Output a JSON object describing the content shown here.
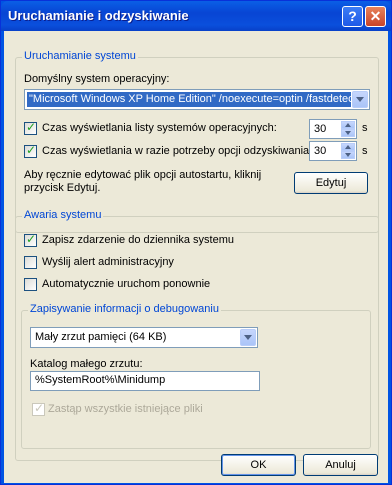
{
  "window": {
    "title": "Uruchamianie i odzyskiwanie",
    "help_glyph": "?",
    "close_glyph": "✕"
  },
  "startup": {
    "group_label": "Uruchamianie systemu",
    "default_os_label": "Domyślny system operacyjny:",
    "default_os_value": "\"Microsoft Windows XP Home Edition\" /noexecute=optin /fastdetect",
    "list_time_label": "Czas wyświetlania listy systemów operacyjnych:",
    "list_time_checked": true,
    "list_time_value": "30",
    "list_time_unit": "s",
    "recovery_time_label": "Czas wyświetlania w razie potrzeby opcji odzyskiwania:",
    "recovery_time_checked": true,
    "recovery_time_value": "30",
    "recovery_time_unit": "s",
    "edit_hint": "Aby ręcznie edytować plik opcji autostartu, kliknij przycisk Edytuj.",
    "edit_button": "Edytuj"
  },
  "failure": {
    "group_label": "Awaria systemu",
    "write_event_label": "Zapisz zdarzenie do dziennika systemu",
    "write_event_checked": true,
    "send_alert_label": "Wyślij alert administracyjny",
    "send_alert_checked": false,
    "auto_restart_label": "Automatycznie uruchom ponownie",
    "auto_restart_checked": false
  },
  "debug": {
    "group_label": "Zapisywanie informacji o debugowaniu",
    "dump_type_value": "Mały zrzut pamięci (64 KB)",
    "dir_label": "Katalog małego zrzutu:",
    "dir_value": "%SystemRoot%\\Minidump",
    "overwrite_label": "Zastąp wszystkie istniejące pliki",
    "overwrite_checked": true,
    "overwrite_disabled": true
  },
  "buttons": {
    "ok": "OK",
    "cancel": "Anuluj"
  }
}
